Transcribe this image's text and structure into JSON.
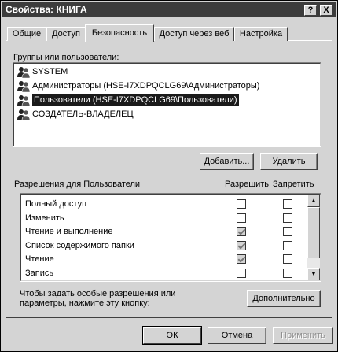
{
  "window": {
    "title": "Свойства: КНИГА",
    "help_btn": "?",
    "close_btn": "X"
  },
  "tabs": [
    {
      "label": "Общие"
    },
    {
      "label": "Доступ"
    },
    {
      "label": "Безопасность"
    },
    {
      "label": "Доступ через веб"
    },
    {
      "label": "Настройка"
    }
  ],
  "active_tab": "Безопасность",
  "groups": {
    "label": "Группы или пользователи:",
    "items": [
      {
        "name": "SYSTEM"
      },
      {
        "name": "Администраторы (HSE-I7XDPQCLG69\\Администраторы)"
      },
      {
        "name": "Пользователи (HSE-I7XDPQCLG69\\Пользователи)"
      },
      {
        "name": "СОЗДАТЕЛЬ-ВЛАДЕЛЕЦ"
      }
    ],
    "selected_index": 2
  },
  "buttons": {
    "add": "Добавить...",
    "remove": "Удалить",
    "advanced": "Дополнительно",
    "ok": "ОК",
    "cancel": "Отмена",
    "apply": "Применить"
  },
  "permissions": {
    "label": "Разрешения для Пользователи",
    "allow_header": "Разрешить",
    "deny_header": "Запретить",
    "rows": [
      {
        "name": "Полный доступ",
        "allow": false,
        "deny": false
      },
      {
        "name": "Изменить",
        "allow": false,
        "deny": false
      },
      {
        "name": "Чтение и выполнение",
        "allow": true,
        "deny": false
      },
      {
        "name": "Список содержимого папки",
        "allow": true,
        "deny": false
      },
      {
        "name": "Чтение",
        "allow": true,
        "deny": false
      },
      {
        "name": "Запись",
        "allow": false,
        "deny": false
      }
    ]
  },
  "advanced_hint": {
    "line1": "Чтобы задать особые разрешения или",
    "line2": "параметры, нажмите эту кнопку:"
  },
  "colors": {
    "dialog_bg": "#d4d4d4",
    "title_bg": "#3c3c3c",
    "selection_bg": "#1a1a1a"
  }
}
